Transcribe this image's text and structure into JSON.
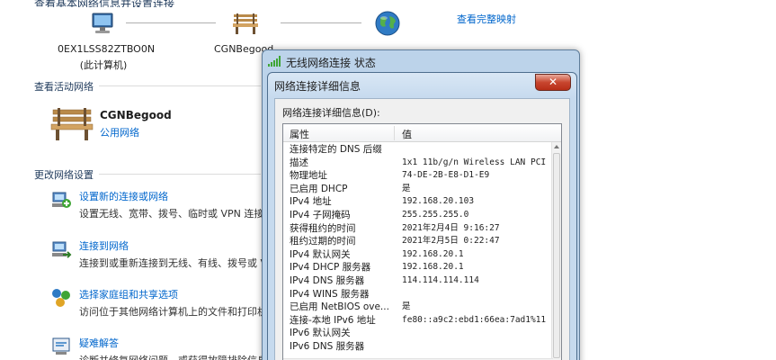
{
  "background": {
    "top_cut_text": "查看基本网络信息并设置连接",
    "map": {
      "computer_line1": "0EX1LSS82ZTBO0N",
      "computer_line2": "(此计算机)",
      "network_name": "CGNBegood",
      "full_map_link": "查看完整映射",
      "computer_icon": "computer-icon",
      "bench_icon": "bench-icon",
      "globe_icon": "globe-icon"
    },
    "active_networks_title": "查看活动网络",
    "active_network": {
      "name": "CGNBegood",
      "type": "公用网络",
      "icon": "bench-icon"
    },
    "change_settings_title": "更改网络设置",
    "tasks": [
      {
        "link": "设置新的连接或网络",
        "desc": "设置无线、宽带、拨号、临时或 VPN 连接",
        "icon": "new-connection-icon"
      },
      {
        "link": "连接到网络",
        "desc": "连接到或重新连接到无线、有线、拨号或 VPN",
        "icon": "connect-network-icon"
      },
      {
        "link": "选择家庭组和共享选项",
        "desc": "访问位于其他网络计算机上的文件和打印机",
        "icon": "homegroup-icon"
      },
      {
        "link": "疑难解答",
        "desc": "诊断并修复网络问题，或获得故障排除信息",
        "icon": "troubleshoot-icon"
      }
    ]
  },
  "outer_window": {
    "title": "无线网络连接 状态",
    "icon": "wireless-signal-icon"
  },
  "details_window": {
    "title": "网络连接详细信息",
    "close_glyph": "✕",
    "label": "网络连接详细信息(D):",
    "columns": [
      "属性",
      "值"
    ],
    "rows": [
      {
        "property": "连接特定的 DNS 后缀",
        "value": ""
      },
      {
        "property": "描述",
        "value": "1x1 11b/g/n Wireless LAN PCI E"
      },
      {
        "property": "物理地址",
        "value": "74-DE-2B-E8-D1-E9"
      },
      {
        "property": "已启用 DHCP",
        "value": "是"
      },
      {
        "property": "IPv4 地址",
        "value": "192.168.20.103"
      },
      {
        "property": "IPv4 子网掩码",
        "value": "255.255.255.0"
      },
      {
        "property": "获得租约的时间",
        "value": "2021年2月4日 9:16:27"
      },
      {
        "property": "租约过期的时间",
        "value": "2021年2月5日 0:22:47"
      },
      {
        "property": "IPv4 默认网关",
        "value": "192.168.20.1"
      },
      {
        "property": "IPv4 DHCP 服务器",
        "value": "192.168.20.1"
      },
      {
        "property": "IPv4 DNS 服务器",
        "value": "114.114.114.114"
      },
      {
        "property": "IPv4 WINS 服务器",
        "value": ""
      },
      {
        "property": "已启用 NetBIOS ove...",
        "value": "是"
      },
      {
        "property": "连接-本地 IPv6 地址",
        "value": "fe80::a9c2:ebd1:66ea:7ad1%11"
      },
      {
        "property": "IPv6 默认网关",
        "value": ""
      },
      {
        "property": "IPv6 DNS 服务器",
        "value": ""
      }
    ]
  },
  "colors": {
    "link": "#0066cc",
    "section_title": "#1e395b",
    "window_frame": "#bcd3ea",
    "close_button": "#c8462f"
  }
}
